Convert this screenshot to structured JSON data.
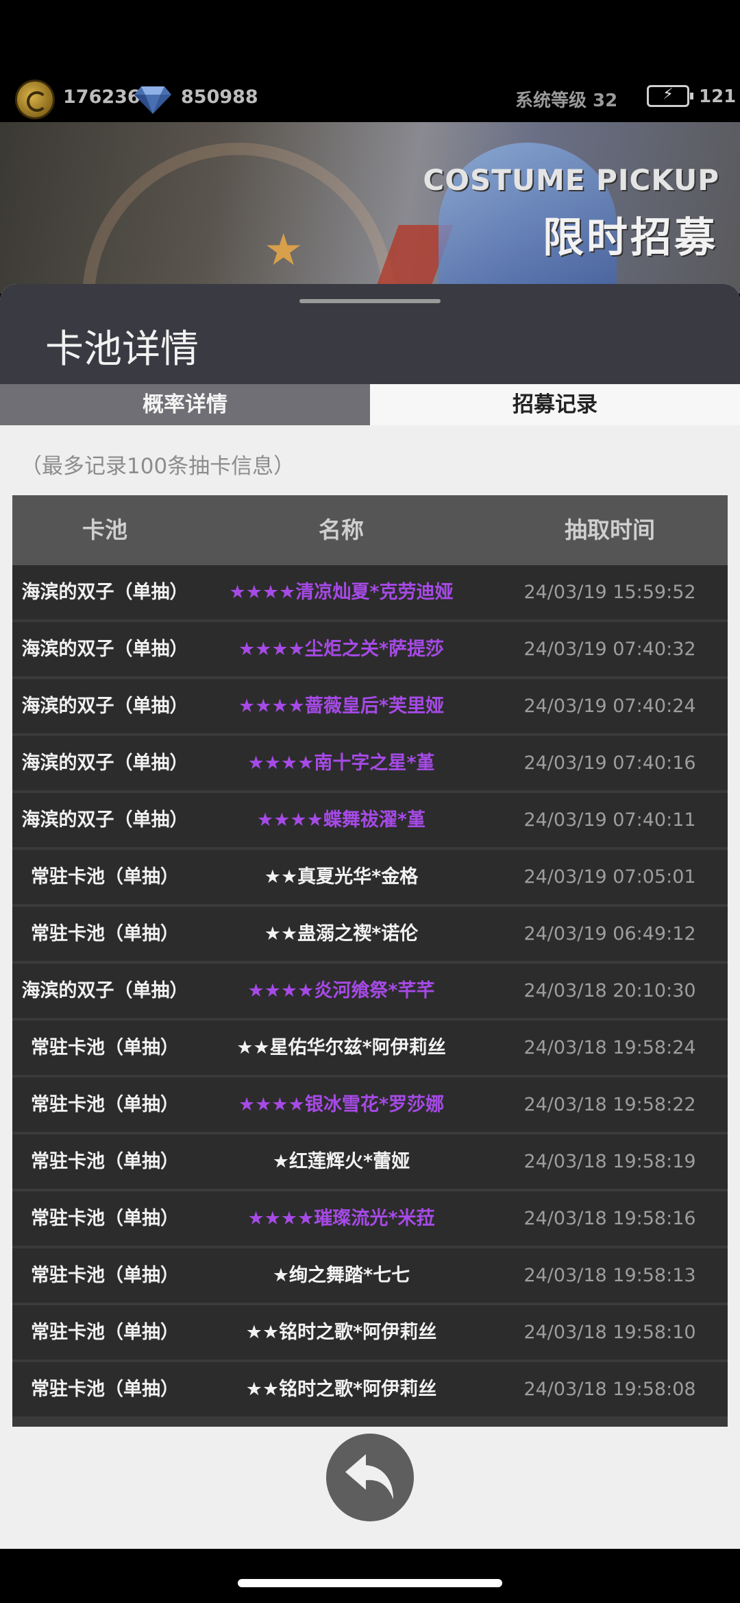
{
  "status": {
    "coins": "176236",
    "gems": "850988",
    "system_level_label": "系统等级 32",
    "energy_value": "121"
  },
  "banner": {
    "title_en": "COSTUME PICKUP",
    "title_cn": "限时招募"
  },
  "sheet": {
    "title": "卡池详情",
    "tabs": [
      {
        "label": "概率详情",
        "active": false
      },
      {
        "label": "招募记录",
        "active": true
      }
    ],
    "note": "（最多记录100条抽卡信息）"
  },
  "table": {
    "headers": [
      "卡池",
      "名称",
      "抽取时间"
    ],
    "rows": [
      {
        "pool": "海滨的双子（单抽）",
        "name": "★★★★清凉灿夏*克劳迪娅",
        "time": "24/03/19 15:59:52",
        "rarity": 4
      },
      {
        "pool": "海滨的双子（单抽）",
        "name": "★★★★尘炬之关*萨提莎",
        "time": "24/03/19 07:40:32",
        "rarity": 4
      },
      {
        "pool": "海滨的双子（单抽）",
        "name": "★★★★蔷薇皇后*芙里娅",
        "time": "24/03/19 07:40:24",
        "rarity": 4
      },
      {
        "pool": "海滨的双子（单抽）",
        "name": "★★★★南十字之星*堇",
        "time": "24/03/19 07:40:16",
        "rarity": 4
      },
      {
        "pool": "海滨的双子（单抽）",
        "name": "★★★★蝶舞祓濯*堇",
        "time": "24/03/19 07:40:11",
        "rarity": 4
      },
      {
        "pool": "常驻卡池（单抽）",
        "name": "★★真夏光华*金格",
        "time": "24/03/19 07:05:01",
        "rarity": 2
      },
      {
        "pool": "常驻卡池（单抽）",
        "name": "★★蛊溺之禊*诺伦",
        "time": "24/03/19 06:49:12",
        "rarity": 2
      },
      {
        "pool": "海滨的双子（单抽）",
        "name": "★★★★炎河飨祭*芊芊",
        "time": "24/03/18 20:10:30",
        "rarity": 4
      },
      {
        "pool": "常驻卡池（单抽）",
        "name": "★★星佑华尔兹*阿伊莉丝",
        "time": "24/03/18 19:58:24",
        "rarity": 2
      },
      {
        "pool": "常驻卡池（单抽）",
        "name": "★★★★银冰雪花*罗莎娜",
        "time": "24/03/18 19:58:22",
        "rarity": 4
      },
      {
        "pool": "常驻卡池（单抽）",
        "name": "★红莲辉火*蕾娅",
        "time": "24/03/18 19:58:19",
        "rarity": 1
      },
      {
        "pool": "常驻卡池（单抽）",
        "name": "★★★★璀璨流光*米菈",
        "time": "24/03/18 19:58:16",
        "rarity": 4
      },
      {
        "pool": "常驻卡池（单抽）",
        "name": "★绚之舞踏*七七",
        "time": "24/03/18 19:58:13",
        "rarity": 1
      },
      {
        "pool": "常驻卡池（单抽）",
        "name": "★★铭时之歌*阿伊莉丝",
        "time": "24/03/18 19:58:10",
        "rarity": 2
      },
      {
        "pool": "常驻卡池（单抽）",
        "name": "★★铭时之歌*阿伊莉丝",
        "time": "24/03/18 19:58:08",
        "rarity": 2
      }
    ]
  },
  "colors": {
    "rarity_4": "#a64ae6",
    "rarity_low": "#f2f2f2",
    "header_bg": "#3a3a43",
    "active_tab_bg": "#f7f7f7",
    "inactive_tab_bg": "#6f6f75"
  },
  "icons": {
    "coin": "gold-coin-icon",
    "gem": "diamond-icon",
    "energy": "battery-lightning-icon",
    "back": "back-arrow-icon"
  }
}
